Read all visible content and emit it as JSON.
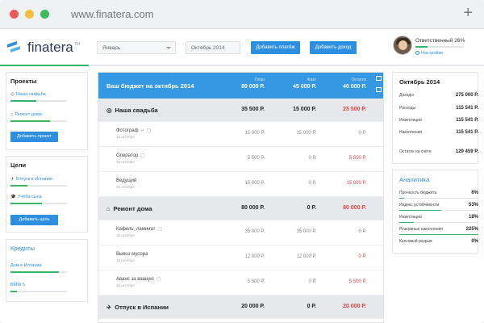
{
  "browser": {
    "url": "www.finatera.com",
    "new_tab_icon": "plus-icon"
  },
  "header": {
    "logo_text": "finatera",
    "logo_tm": "TM",
    "month_select": "Январь",
    "period_select": "Октябрь 2014",
    "add_payment_label": "Добавить платёж",
    "add_income_label": "Добавить доход",
    "user": {
      "name": "Ответственный 26%",
      "progress": 0.26,
      "settings_label": "Настройки"
    }
  },
  "sidebar": {
    "projects": {
      "title": "Проекты",
      "items": [
        {
          "label": "Наша свадьба",
          "icon": "rings-icon",
          "progress": 0.45
        },
        {
          "label": "Ремонт дома",
          "icon": "home-icon",
          "progress": 0.7
        }
      ],
      "add_label": "Добавить проект"
    },
    "goals": {
      "title": "Цели",
      "items": [
        {
          "label": "Отпуск в Испании",
          "icon": "plane-icon",
          "progress": 0.3
        },
        {
          "label": "Учёба сына",
          "icon": "graduation-cap-icon",
          "progress": 0.55
        }
      ],
      "add_label": "Добавить цель"
    },
    "credits": {
      "title": "Кредиты",
      "items": [
        {
          "label": "Дом в Испании",
          "progress": 0.85
        },
        {
          "label": "BMW 5",
          "progress": 0.12
        }
      ]
    }
  },
  "budget": {
    "title": "Ваш бюджет на октябрь 2014",
    "columns": [
      {
        "label": "План",
        "value": "80 000 Р."
      },
      {
        "label": "Факт",
        "value": "45 000 Р."
      },
      {
        "label": "Остаток",
        "value": "40 000 Р."
      }
    ],
    "rows": [
      {
        "type": "group",
        "icon": "rings-icon",
        "name": "Наша свадьба",
        "plan": "35 500 Р.",
        "fact": "15 000 Р.",
        "rest": "25 500 Р."
      },
      {
        "type": "item",
        "name": "Фотограф",
        "date": "10 октября",
        "plan": "15 000 Р.",
        "fact": "15 000 Р.",
        "rest": "0 Р."
      },
      {
        "type": "item",
        "name": "Оператор",
        "date": "25 октября",
        "plan": "5 500 Р.",
        "fact": "0 Р.",
        "rest": "5 500 Р."
      },
      {
        "type": "item",
        "name": "Ведущий",
        "date": "25 октября",
        "plan": "15 000 Р.",
        "fact": "0 Р.",
        "rest": "15 000 Р."
      },
      {
        "type": "group",
        "icon": "home-icon",
        "name": "Ремонт дома",
        "plan": "80 000 Р.",
        "fact": "0 Р.",
        "rest": "80 000 Р."
      },
      {
        "type": "item",
        "name": "Кафель, ламинат",
        "date": "10 октября",
        "plan": "35 000 Р.",
        "fact": "35 000 Р.",
        "rest": "0 Р."
      },
      {
        "type": "item",
        "name": "Вывоз мусора",
        "date": "15 октября",
        "plan": "12 000 Р.",
        "fact": "12 000 Р.",
        "rest": "0 Р."
      },
      {
        "type": "item",
        "name": "Аванс за ванную",
        "date": "25 октября",
        "plan": "5 500 Р.",
        "fact": "0 Р.",
        "rest": "5 500 Р."
      },
      {
        "type": "group",
        "icon": "plane-icon",
        "name": "Отпуск в Испании",
        "plan": "20 000 Р.",
        "fact": "0 Р.",
        "rest": "20 000 Р."
      }
    ]
  },
  "summary": {
    "title": "Октябрь 2014",
    "rows": [
      {
        "label": "Доходы",
        "value": "275 000 Р."
      },
      {
        "label": "Расходы",
        "value": "115 541 Р."
      },
      {
        "label": "Инвестиции",
        "value": "115 541 Р."
      },
      {
        "label": "Накопления",
        "value": "115 541 Р."
      },
      {
        "label": "Остаток на счёте",
        "value": "129 459 Р."
      }
    ]
  },
  "analytics": {
    "title": "Аналитика",
    "rows": [
      {
        "label": "Прочность бюджета",
        "value": "6%",
        "progress": 0.06
      },
      {
        "label": "Индекс устойчивости",
        "value": "53%",
        "progress": 0.53
      },
      {
        "label": "Инвестиции",
        "value": "18%",
        "progress": 0.18
      },
      {
        "label": "Резервные накопления",
        "value": "225%",
        "progress": 1.0
      },
      {
        "label": "Кассовый разрыв",
        "value": "0%",
        "progress": 0
      }
    ]
  },
  "colors": {
    "accent": "#2e8fe0",
    "header_blue": "#3598e3",
    "progress_green": "#37b46a",
    "negative_red": "#e04444"
  }
}
